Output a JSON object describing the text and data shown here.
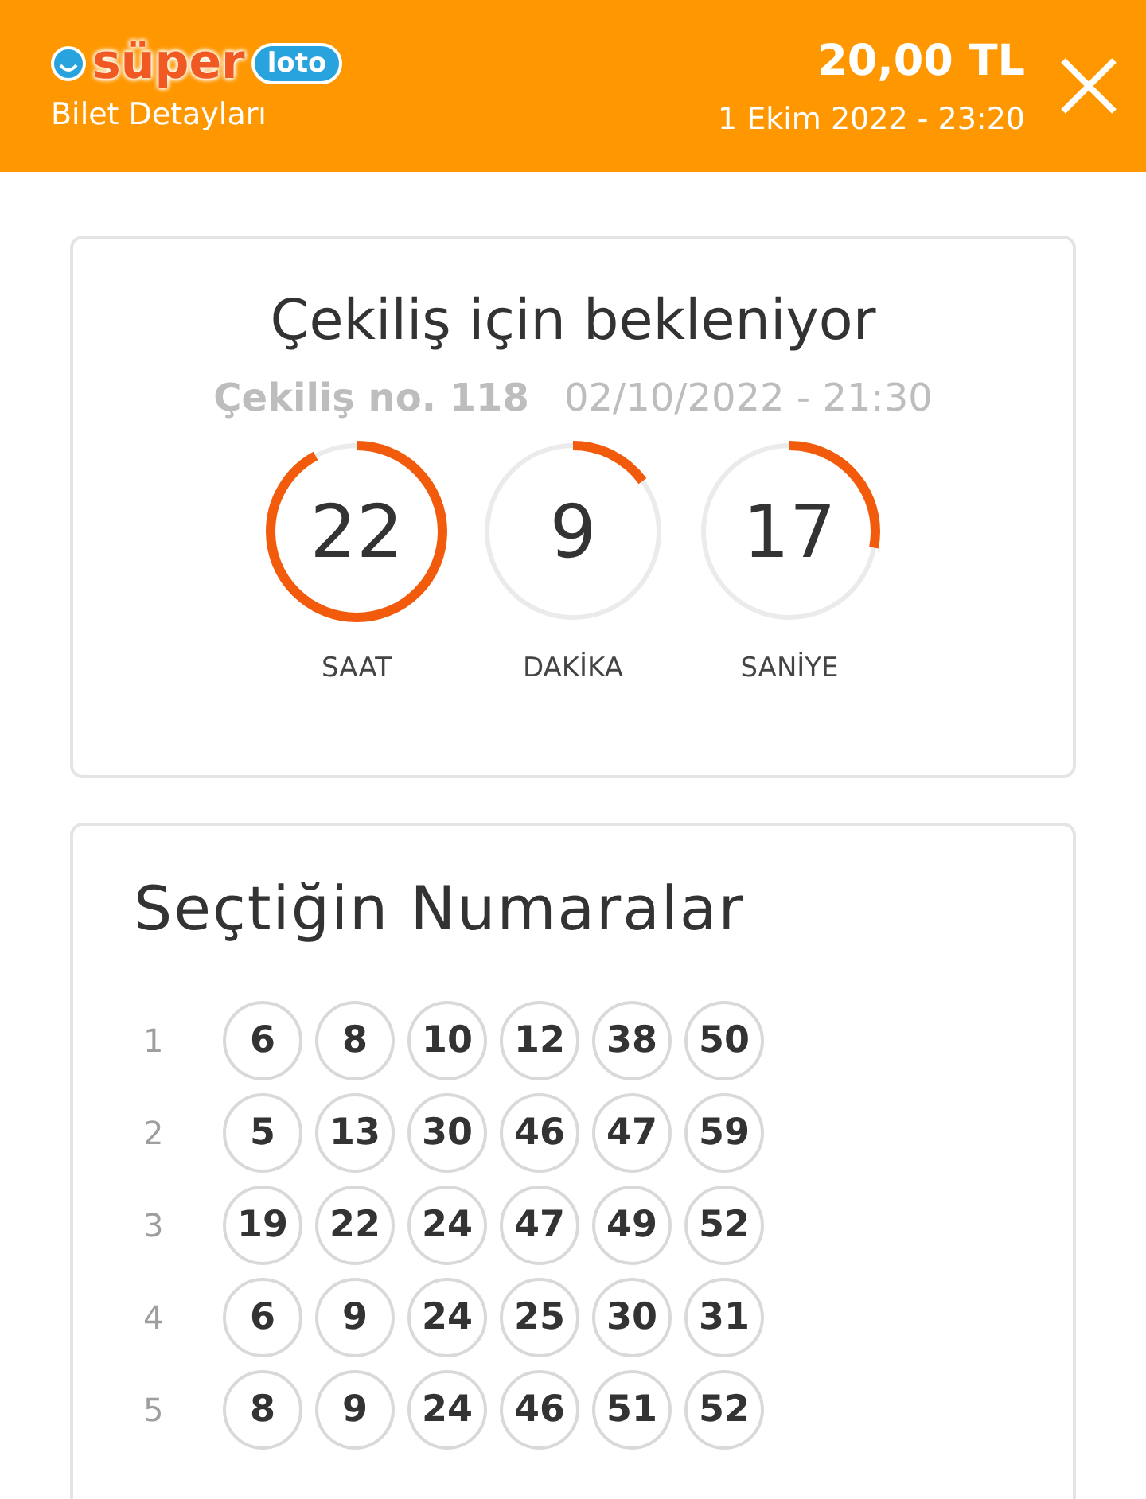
{
  "header": {
    "logo": {
      "word_1": "süper",
      "word_2": "loto"
    },
    "subtitle": "Bilet Detayları",
    "price": "20,00 TL",
    "date": "1 Ekim 2022 - 23:20"
  },
  "draw_card": {
    "title": "Çekiliş için bekleniyor",
    "draw_no": "Çekiliş no. 118",
    "draw_date": "02/10/2022 - 21:30",
    "timers": [
      {
        "value": "22",
        "label": "SAAT",
        "level": 0.92
      },
      {
        "value": "9",
        "label": "DAKİKA",
        "level": 0.15
      },
      {
        "value": "17",
        "label": "SANİYE",
        "level": 0.28
      }
    ]
  },
  "numbers_card": {
    "title": "Seçtiğin Numaralar",
    "rows": [
      {
        "index": "1",
        "numbers": [
          "6",
          "8",
          "10",
          "12",
          "38",
          "50"
        ]
      },
      {
        "index": "2",
        "numbers": [
          "5",
          "13",
          "30",
          "46",
          "47",
          "59"
        ]
      },
      {
        "index": "3",
        "numbers": [
          "19",
          "22",
          "24",
          "47",
          "49",
          "52"
        ]
      },
      {
        "index": "4",
        "numbers": [
          "6",
          "9",
          "24",
          "25",
          "30",
          "31"
        ]
      },
      {
        "index": "5",
        "numbers": [
          "8",
          "9",
          "24",
          "46",
          "51",
          "52"
        ]
      }
    ]
  }
}
